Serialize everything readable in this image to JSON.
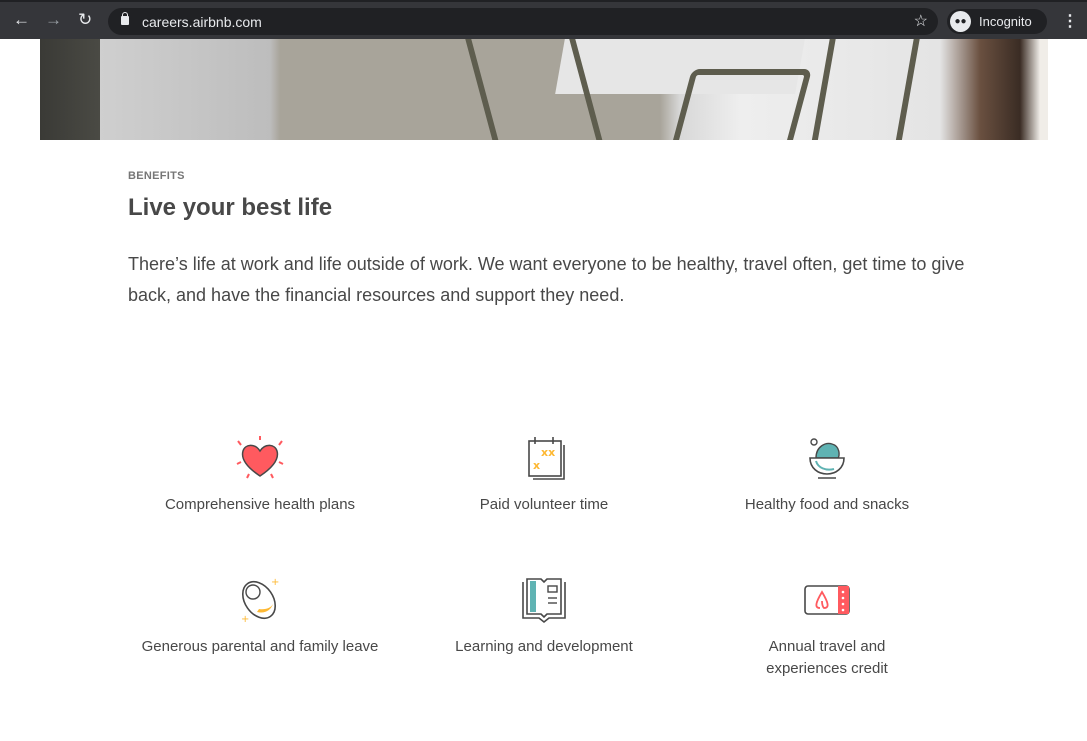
{
  "browser": {
    "url": "careers.airbnb.com",
    "profile": "Incognito"
  },
  "section": {
    "eyebrow": "BENEFITS",
    "title": "Live your best life",
    "intro": "There’s life at work and life outside of work. We want everyone to be healthy, travel often, get time to give back, and have the financial resources and support they need."
  },
  "benefits": [
    {
      "label": "Comprehensive health plans",
      "icon": "heart-icon"
    },
    {
      "label": "Paid volunteer time",
      "icon": "calendar-icon"
    },
    {
      "label": "Healthy food and snacks",
      "icon": "salad-bowl-icon"
    },
    {
      "label": "Generous parental and family leave",
      "icon": "baby-icon"
    },
    {
      "label": "Learning and development",
      "icon": "book-icon"
    },
    {
      "label": "Annual travel and experiences credit",
      "icon": "travel-ticket-icon"
    }
  ],
  "colors": {
    "coral": "#ff5a5f",
    "teal": "#5fb3b3",
    "yellow": "#fdb833",
    "text": "#484848"
  }
}
